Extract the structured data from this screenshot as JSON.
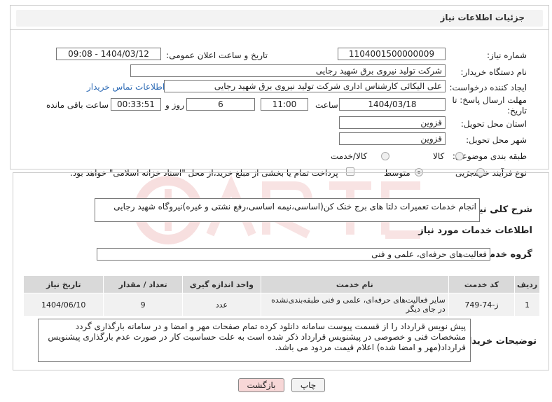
{
  "header": {
    "title": "جزئیات اطلاعات نیاز"
  },
  "fields": {
    "need_number_label": "شماره نیاز:",
    "need_number": "1104001500000009",
    "announce_label": "تاریخ و ساعت اعلان عمومی:",
    "announce_value": "1404/03/12 - 09:08",
    "buyer_label": "نام دستگاه خریدار:",
    "buyer_value": "شرکت تولید نیروی برق شهید رجایی",
    "creator_label": "ایجاد کننده درخواست:",
    "creator_value": "علی الیکائی کارشناس اداری شرکت تولید نیروی برق شهید رجایی",
    "contact_link": "اطلاعات تماس خریدار",
    "deadline_label_1": "مهلت ارسال پاسخ: تا",
    "deadline_label_2": "تاریخ:",
    "deadline_date": "1404/03/18",
    "time_label": "ساعت",
    "deadline_time": "11:00",
    "days_value": "6",
    "days_label": "روز و",
    "remaining_value": "00:33:51",
    "remaining_label": "ساعت باقی مانده",
    "province_label": "استان محل تحویل:",
    "province_value": "قزوین",
    "city_label": "شهر محل تحویل:",
    "city_value": "قزوین",
    "category_label": "طبقه بندی موضوعی:",
    "category_options": [
      "کالا",
      "کالا/خدمت"
    ],
    "purchase_label": "نوع فرآیند خرید :",
    "purchase_options": [
      "جزیی",
      "متوسط"
    ],
    "payment_note": "پرداخت تمام یا بخشی از مبلغ خرید،از محل \"اسناد خزانه اسلامی\" خواهد بود."
  },
  "description": {
    "label": "شرح کلی نیاز:",
    "value": "انجام خدمات تعمیرات دلتا های برج خنک کن(اساسی،نیمه اساسی،رفع نشتی و غیره)نیروگاه شهید رجایی"
  },
  "services": {
    "section_title": "اطلاعات خدمات مورد نیاز",
    "group_label": "گروه خدمت:",
    "group_value": "فعالیت‌های حرفه‌ای، علمی و فنی",
    "columns": [
      "ردیف",
      "کد خدمت",
      "نام خدمت",
      "واحد اندازه گیری",
      "تعداد / مقدار",
      "تاریخ نیاز"
    ],
    "rows": [
      {
        "row": "1",
        "code": "ز-74-749",
        "name": "سایر فعالیت‌های حرفه‌ای، علمی و فنی طبقه‌بندی‌نشده در جای دیگر",
        "unit": "عدد",
        "qty": "9",
        "date": "1404/06/10"
      }
    ]
  },
  "buyer_notes": {
    "label": "توضیحات خریدار:",
    "value": "پیش نویس قرارداد را از قسمت پیوست سامانه دانلود کرده تمام صفحات مهر و امضا و در سامانه بارگذاری گردد مشخصات فنی و خصوصی در پیشنویس قرارداد ذکر شده است به علت حساسیت کار در صورت عدم بارگذاری پیشنویس قرارداد(مهر و امضا شده) اعلام قیمت مردود می باشد."
  },
  "buttons": {
    "print": "چاپ",
    "back": "بازگشت"
  },
  "colors": {
    "link": "#2e6bb5",
    "back_button": "#f7d7d7",
    "header_bg": "#f3f3f3"
  }
}
